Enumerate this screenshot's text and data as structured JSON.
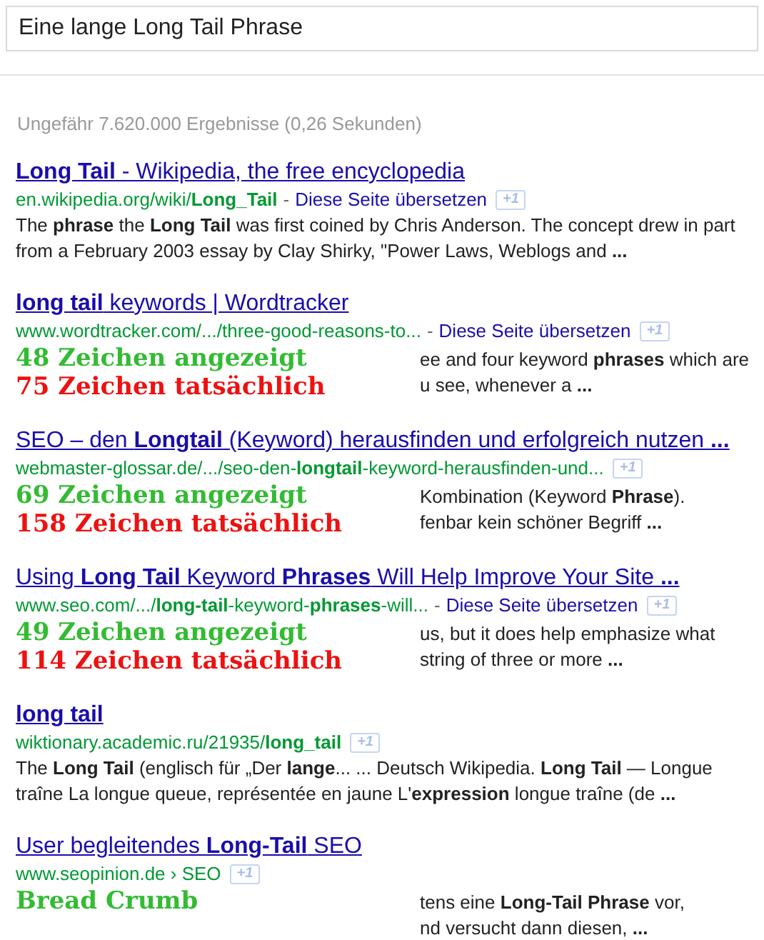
{
  "search": {
    "value": "Eine lange Long Tail Phrase"
  },
  "result_stats": "Ungefähr 7.620.000 Ergebnisse (0,26 Sekunden)",
  "results": [
    {
      "title": "**Long Tail** - Wikipedia, the free encyclopedia",
      "url": "en.wikipedia.org/wiki/**Long_Tail**",
      "separator": "-",
      "translate": "Diese Seite übersetzen",
      "plus_one": "+1",
      "snippet": [
        "The **phrase** the **Long Tail** was first coined by Chris Anderson. The concept drew in part",
        "from a February 2003 essay by Clay Shirky, \"Power Laws, Weblogs and **...**"
      ]
    },
    {
      "title": "**long tail** keywords | Wordtracker",
      "url": "www.wordtracker.com/.../three-good-reasons-to...",
      "separator": "-",
      "translate": "Diese Seite übersetzen",
      "plus_one": "+1",
      "annotation": [
        {
          "text": "48 Zeichen angezeigt",
          "color": "#33bb33"
        },
        {
          "text": "75 Zeichen tatsächlich",
          "color": "#ee1111"
        }
      ],
      "snippet": [
        "ee and four keyword **phrases** which are",
        "u see, whenever a **...**"
      ]
    },
    {
      "title": "SEO – den **Longtail** (Keyword) herausfinden und erfolgreich nutzen **...**",
      "url": "webmaster-glossar.de/.../seo-den-**longtail**-keyword-herausfinden-und...",
      "plus_one": "+1",
      "annotation": [
        {
          "text": "69 Zeichen angezeigt",
          "color": "#33bb33"
        },
        {
          "text": "158 Zeichen tatsächlich",
          "color": "#ee1111"
        }
      ],
      "snippet": [
        "Kombination (Keyword **Phrase**).",
        "fenbar kein schöner Begriff **...**"
      ]
    },
    {
      "title": "Using **Long Tail** Keyword **Phrases** Will Help Improve Your Site **...**",
      "url": "www.seo.com/.../**long-tail**-keyword-**phrases**-will...",
      "separator": "-",
      "translate": "Diese Seite übersetzen",
      "plus_one": "+1",
      "annotation": [
        {
          "text": "49 Zeichen angezeigt",
          "color": "#33bb33"
        },
        {
          "text": "114 Zeichen tatsächlich",
          "color": "#ee1111"
        }
      ],
      "snippet": [
        "us, but it does help emphasize what",
        "string of three or more **...**"
      ]
    },
    {
      "title": "**long tail**",
      "url": "wiktionary.academic.ru/21935/**long_tail**",
      "plus_one": "+1",
      "snippet": [
        "The **Long Tail** (englisch für „Der **lange**... ... Deutsch Wikipedia. **Long Tail** — Longue",
        "traîne La longue queue, représentée en jaune L'**expression** longue traîne (de **...**"
      ]
    },
    {
      "title": "User begleitendes **Long-Tail** SEO",
      "url": "www.seopinion.de › SEO",
      "plus_one": "+1",
      "annotation": [
        {
          "text": "Bread Crumb",
          "color": "#33bb33"
        }
      ],
      "snippet": [
        "tens eine **Long-Tail Phrase** vor,",
        "nd versucht dann diesen, **...**"
      ]
    }
  ]
}
